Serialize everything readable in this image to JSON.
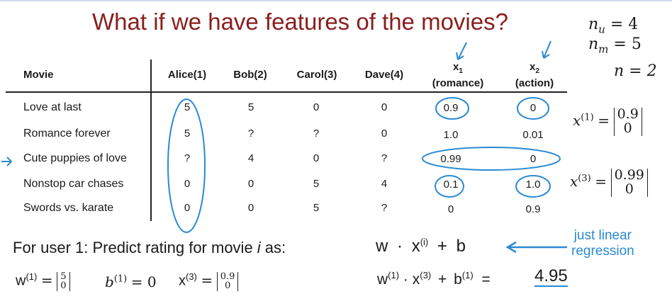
{
  "title": "What if we have features of the movies?",
  "params": {
    "nu": "n",
    "nu_sub": "u",
    "nu_val": "= 4",
    "nm": "n",
    "nm_sub": "m",
    "nm_val": "= 5",
    "n": "n = 2"
  },
  "table": {
    "headers": [
      "Movie",
      "Alice(1)",
      "Bob(2)",
      "Carol(3)",
      "Dave(4)"
    ],
    "feature_headers": [
      {
        "var": "x",
        "sub": "1",
        "label": "(romance)"
      },
      {
        "var": "x",
        "sub": "2",
        "label": "(action)"
      }
    ],
    "rows": [
      {
        "movie": "Love at last",
        "ratings": [
          "5",
          "5",
          "0",
          "0"
        ],
        "x1": "0.9",
        "x2": "0"
      },
      {
        "movie": "Romance forever",
        "ratings": [
          "5",
          "?",
          "?",
          "0"
        ],
        "x1": "1.0",
        "x2": "0.01"
      },
      {
        "movie": "Cute puppies of love",
        "ratings": [
          "?",
          "4",
          "0",
          "?"
        ],
        "x1": "0.99",
        "x2": "0"
      },
      {
        "movie": "Nonstop car chases",
        "ratings": [
          "0",
          "0",
          "5",
          "4"
        ],
        "x1": "0.1",
        "x2": "1.0"
      },
      {
        "movie": "Swords vs. karate",
        "ratings": [
          "0",
          "0",
          "5",
          "?"
        ],
        "x1": "0",
        "x2": "0.9"
      }
    ]
  },
  "side": {
    "x1_lhs": "x",
    "x1_sup": "(1)",
    "x1_eq": "=",
    "x1_vec": [
      "0.9",
      "0"
    ],
    "x3_lhs": "x",
    "x3_sup": "(3)",
    "x3_eq": "=",
    "x3_vec": [
      "0.99",
      "0"
    ]
  },
  "predict": {
    "text": "For user 1: Predict rating for movie ",
    "i": "i",
    "as": " as:",
    "formula_w": "w",
    "formula_dot": "·",
    "formula_x": "x",
    "formula_xsup": "(i)",
    "formula_plus": "+",
    "formula_b": "b",
    "annotation_line1": "just linear",
    "annotation_line2": "regression"
  },
  "bottom": {
    "w_lhs": "w",
    "w_sup": "(1)",
    "w_eq": "=",
    "w_vec": [
      "5",
      "0"
    ],
    "b_lhs": "b",
    "b_sup": "(1)",
    "b_eq": "= 0",
    "x_lhs": "x",
    "x_sup": "(3)",
    "x_eq": "=",
    "x_vec": [
      "0.9",
      "0"
    ],
    "calc_w": "w",
    "calc_wsup": "(1)",
    "calc_dot": "·",
    "calc_x": "x",
    "calc_xsup": "(3)",
    "calc_plus": "+",
    "calc_b": "b",
    "calc_bsup": "(1)",
    "calc_eq": "=",
    "result": "4.95"
  }
}
